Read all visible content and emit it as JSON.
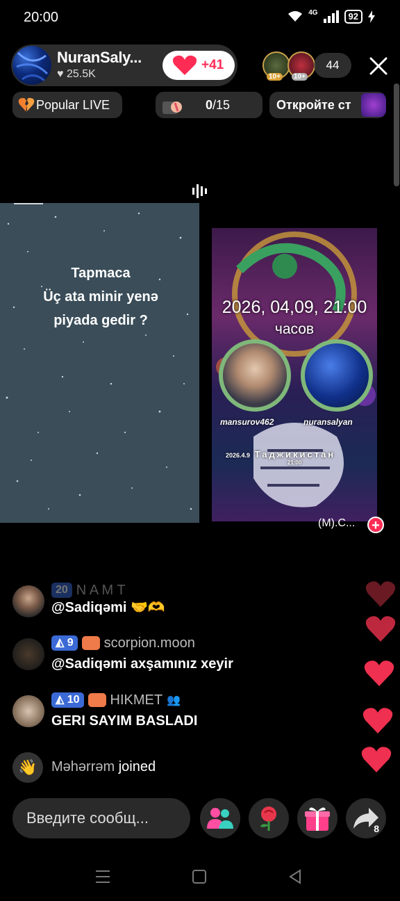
{
  "status_bar": {
    "time": "20:00",
    "network": "4G",
    "battery": "92"
  },
  "host": {
    "name": "NuranSaly...",
    "likes": "25.5K",
    "follow_count": "+41"
  },
  "viewers": {
    "badge1": "10+",
    "badge2": "10+",
    "count": "44"
  },
  "chips": {
    "popular": "Popular LIVE",
    "goal_current": "0",
    "goal_total": "/15",
    "promo": "Откройте ст"
  },
  "left_panel": {
    "riddle_lines": [
      "Tapmaca",
      "Üç ata minir yenə",
      "piyada gedir ?"
    ]
  },
  "right_panel": {
    "date": "2026, 04,09, 21:00",
    "hours": "часов",
    "user1": "mansurov462",
    "user2": "nuransalyan",
    "small_date": "2026.4.9",
    "country": "Таджикистан",
    "small_time": "21:00",
    "label": "(M).C..."
  },
  "chat": [
    {
      "meta_level": "20",
      "meta_name": "N A M T",
      "text": "@Sadiqəmi 🤝🫶"
    },
    {
      "meta_level": "9",
      "meta_name": "scorpion.moon",
      "text": "@Sadiqəmi axşamınız xeyir"
    },
    {
      "meta_level": "10",
      "meta_name": "HIKMET",
      "text": "GERI SAYIM BASLADI"
    },
    {
      "joined_name": "Məhərrəm",
      "joined_text": "joined"
    }
  ],
  "bottom": {
    "input_placeholder": "Введите сообщ...",
    "share_count": "8"
  },
  "colors": {
    "accent": "#fe2c55",
    "level_badge": "#3b6ad6",
    "panel_left": "#3a4d59"
  }
}
